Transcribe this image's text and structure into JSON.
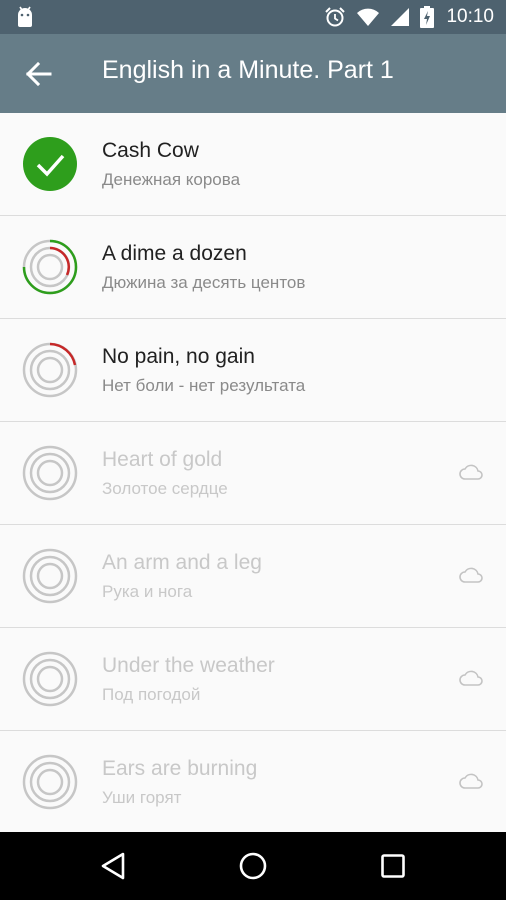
{
  "status_bar": {
    "time": "10:10",
    "icons": [
      "android-icon",
      "alarm-icon",
      "wifi-icon",
      "signal-icon",
      "battery-charging-icon"
    ]
  },
  "app_bar": {
    "title": "English in a Minute. Part 1",
    "back_icon": "arrow-back-icon"
  },
  "items": [
    {
      "title": "Cash Cow",
      "subtitle": "Денежная корова",
      "status": "completed",
      "locked": false
    },
    {
      "title": "A dime a dozen",
      "subtitle": "Дюжина за десять центов",
      "status": "in-progress",
      "locked": false
    },
    {
      "title": "No pain, no gain",
      "subtitle": "Нет боли - нет результата",
      "status": "started",
      "locked": false
    },
    {
      "title": "Heart of gold",
      "subtitle": "Золотое сердце",
      "status": "locked",
      "locked": true,
      "icon": "cloud-icon"
    },
    {
      "title": "An arm and a leg",
      "subtitle": "Рука и нога",
      "status": "locked",
      "locked": true,
      "icon": "cloud-icon"
    },
    {
      "title": "Under the weather",
      "subtitle": "Под погодой",
      "status": "locked",
      "locked": true,
      "icon": "cloud-icon"
    },
    {
      "title": "Ears are burning",
      "subtitle": "Уши горят",
      "status": "locked",
      "locked": true,
      "icon": "cloud-icon"
    }
  ],
  "nav_bar": {
    "icons": [
      "back-triangle-icon",
      "home-circle-icon",
      "recents-square-icon"
    ]
  },
  "colors": {
    "status_bar": "#4e626f",
    "app_bar": "#667d88",
    "completed_green": "#2e9e1c",
    "progress_red": "#c62828",
    "ring_gray": "#c6c6c6"
  }
}
